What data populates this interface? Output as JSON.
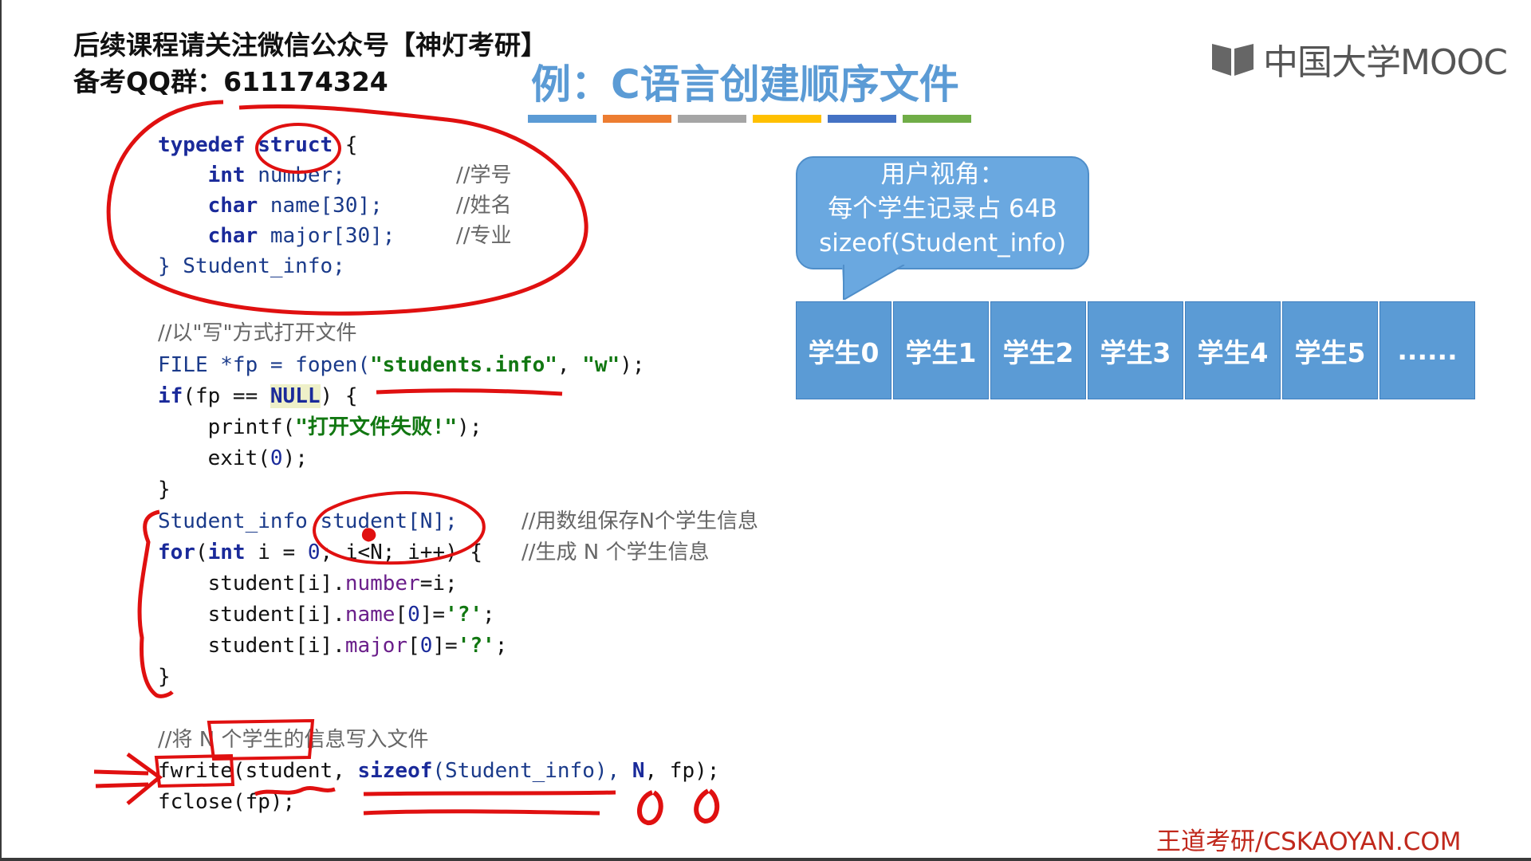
{
  "header": {
    "promo_line1": "后续课程请关注微信公众号【神灯考研】",
    "promo_line2": "备考QQ群：611174324",
    "logo_text": "中国大学MOOC",
    "title": "例：C语言创建顺序文件"
  },
  "title_bar_colors": [
    "#5b9bd5",
    "#ed7d31",
    "#a5a5a5",
    "#ffc000",
    "#4472c4",
    "#70ad47"
  ],
  "code": {
    "l1_kw": "typedef",
    "l1_kw2": "struct",
    "l1_rest": " {",
    "l2_kw": "int",
    "l2_rest": " number;",
    "l2_cm": "//学号",
    "l3_kw": "char",
    "l3_rest": " name[30];",
    "l3_cm": "//姓名",
    "l4_kw": "char",
    "l4_rest": " major[30];",
    "l4_cm": "//专业",
    "l5": "} Student_info;",
    "l7_cm": "//以\"写\"方式打开文件",
    "l8_a": "FILE *fp = fopen(",
    "l8_s1": "\"students.info\"",
    "l8_b": ", ",
    "l8_s2": "\"w\"",
    "l8_c": ");",
    "l9_kw": "if",
    "l9_a": "(fp == ",
    "l9_null": "NULL",
    "l9_b": ") {",
    "l10_a": "printf(",
    "l10_s": "\"打开文件失败!\"",
    "l10_b": ");",
    "l11_a": "exit(",
    "l11_n": "0",
    "l11_b": ");",
    "l12": "}",
    "l13_a": "Student_info student[N];",
    "l13_cm": "//用数组保存N个学生信息",
    "l14_kw": "for",
    "l14_a": "(",
    "l14_kw2": "int",
    "l14_b": " i = ",
    "l14_n": "0",
    "l14_c": "; i<N; i++) {",
    "l14_cm": "//生成 N 个学生信息",
    "l15_a": "student[i].",
    "l15_f": "number",
    "l15_b": "=i;",
    "l16_a": "student[i].",
    "l16_f": "name",
    "l16_b": "[",
    "l16_n": "0",
    "l16_c": "]=",
    "l16_s": "'?'",
    "l16_d": ";",
    "l17_a": "student[i].",
    "l17_f": "major",
    "l17_b": "[",
    "l17_n": "0",
    "l17_c": "]=",
    "l17_s": "'?'",
    "l17_d": ";",
    "l18": "}",
    "l20_cm": "//将 N 个学生的信息写入文件",
    "l21_a": "fwrite(student, ",
    "l21_kw": "sizeof",
    "l21_b": "(Student_info), ",
    "l21_n": "N",
    "l21_c": ", fp);",
    "l22": "fclose(fp);"
  },
  "bubble": {
    "line1": "用户视角：",
    "line2": "每个学生记录占 64B",
    "line3": "sizeof(Student_info)"
  },
  "records": [
    "学生0",
    "学生1",
    "学生2",
    "学生3",
    "学生4",
    "学生5",
    "......"
  ],
  "watermark": "王道考研/CSKAOYAN.COM"
}
